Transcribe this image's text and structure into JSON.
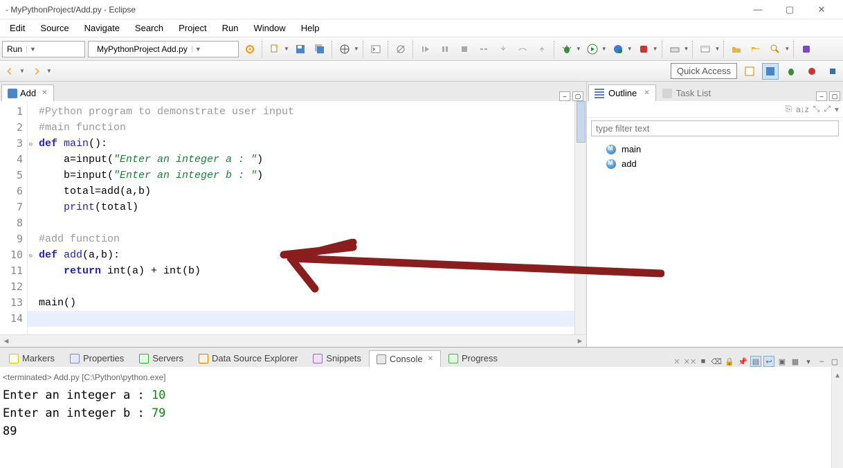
{
  "window": {
    "title": "- MyPythonProject/Add.py - Eclipse"
  },
  "menu": [
    "Edit",
    "Source",
    "Navigate",
    "Search",
    "Project",
    "Run",
    "Window",
    "Help"
  ],
  "toolbar": {
    "run_mode": "Run",
    "project": "MyPythonProject Add.py"
  },
  "quick_access": "Quick Access",
  "editor": {
    "tab_label": "Add",
    "lines": [
      {
        "n": 1,
        "fold": false,
        "html": "<span class='c-comment'>#Python program to demonstrate user input</span>"
      },
      {
        "n": 2,
        "fold": false,
        "html": "<span class='c-comment'>#main function</span>"
      },
      {
        "n": 3,
        "fold": true,
        "html": "<span class='c-kw'>def</span> <span class='c-def'>main</span>():"
      },
      {
        "n": 4,
        "fold": false,
        "html": "    a=input(<span class='c-str'>\"Enter an integer a : \"</span>)"
      },
      {
        "n": 5,
        "fold": false,
        "html": "    b=input(<span class='c-str'>\"Enter an integer b : \"</span>)"
      },
      {
        "n": 6,
        "fold": false,
        "html": "    total=add(a,b)"
      },
      {
        "n": 7,
        "fold": false,
        "html": "    <span class='c-def'>print</span>(total)"
      },
      {
        "n": 8,
        "fold": false,
        "html": ""
      },
      {
        "n": 9,
        "fold": false,
        "html": "<span class='c-comment'>#add function</span>"
      },
      {
        "n": 10,
        "fold": true,
        "html": "<span class='c-kw'>def</span> <span class='c-def'>add</span>(a,b):"
      },
      {
        "n": 11,
        "fold": false,
        "html": "    <span class='c-kw'>return</span> int(a) + int(b)"
      },
      {
        "n": 12,
        "fold": false,
        "html": ""
      },
      {
        "n": 13,
        "fold": false,
        "html": "main()"
      },
      {
        "n": 14,
        "fold": false,
        "html": "",
        "hl": true
      }
    ]
  },
  "outline": {
    "tab": "Outline",
    "tasks_tab": "Task List",
    "filter_placeholder": "type filter text",
    "items": [
      "main",
      "add"
    ]
  },
  "bottom": {
    "tabs": [
      "Markers",
      "Properties",
      "Servers",
      "Data Source Explorer",
      "Snippets",
      "Console",
      "Progress"
    ],
    "active_index": 5,
    "process_line": "<terminated> Add.py [C:\\Python\\python.exe]",
    "output": [
      {
        "prompt": "Enter an integer a : ",
        "input": "10"
      },
      {
        "prompt": "Enter an integer b : ",
        "input": "79"
      },
      {
        "prompt": "89",
        "input": ""
      }
    ]
  }
}
